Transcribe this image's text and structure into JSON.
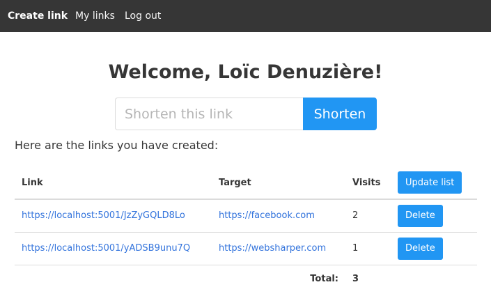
{
  "nav": {
    "create_link": "Create link",
    "my_links": "My links",
    "log_out": "Log out"
  },
  "welcome": "Welcome, Loïc Denuzière!",
  "shorten": {
    "placeholder": "Shorten this link",
    "button": "Shorten"
  },
  "intro": "Here are the links you have created:",
  "table": {
    "headers": {
      "link": "Link",
      "target": "Target",
      "visits": "Visits"
    },
    "update_button": "Update list",
    "rows": [
      {
        "link": "https://localhost:5001/JzZyGQLD8Lo",
        "target": "https://facebook.com",
        "visits": "2",
        "delete": "Delete"
      },
      {
        "link": "https://localhost:5001/yADSB9unu7Q",
        "target": "https://websharper.com",
        "visits": "1",
        "delete": "Delete"
      }
    ],
    "total_label": "Total:",
    "total_value": "3"
  },
  "colors": {
    "navbar": "#363636",
    "accent": "#2196f3",
    "link": "#3273dc"
  }
}
